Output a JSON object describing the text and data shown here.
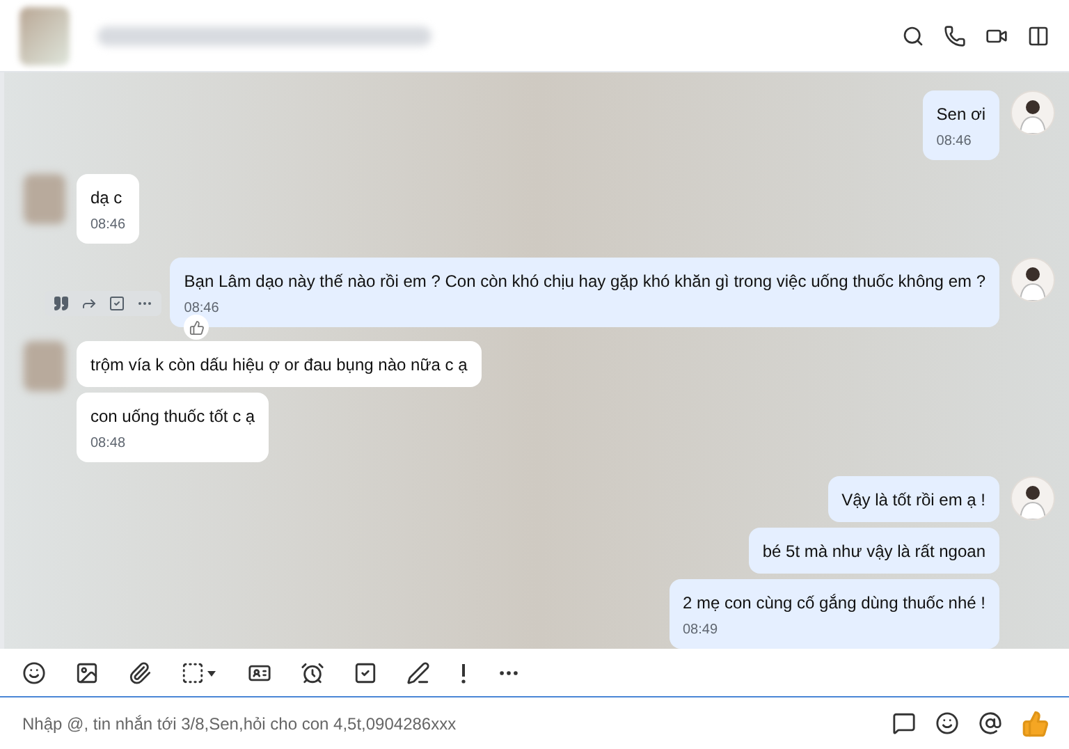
{
  "messages": [
    {
      "kind": "outgoing",
      "text": "Sen ơi",
      "time": "08:46",
      "avatar": true,
      "hovered": false
    },
    {
      "kind": "incoming",
      "text": "dạ c",
      "time": "08:46",
      "avatar": true,
      "hovered": false
    },
    {
      "kind": "outgoing",
      "text": "Bạn Lâm dạo này thế nào rồi em ? Con còn khó chịu hay gặp khó khăn gì trong việc uống thuốc không em ?",
      "time": "08:46",
      "avatar": true,
      "hovered": true
    },
    {
      "kind": "incoming",
      "text": "trộm vía k còn dấu hiệu ợ or đau bụng nào nữa c ạ",
      "avatar": true,
      "hovered": false
    },
    {
      "kind": "incoming",
      "text": "con uống thuốc tốt c ạ",
      "time": "08:48",
      "avatar": false,
      "hovered": false
    },
    {
      "kind": "outgoing",
      "text": "Vậy là tốt rồi em ạ !",
      "avatar": true,
      "hovered": false
    },
    {
      "kind": "outgoing",
      "text": "bé 5t mà như vậy là rất ngoan",
      "avatar": false,
      "hovered": false
    },
    {
      "kind": "outgoing",
      "text": "2 mẹ con cùng cố gắng dùng thuốc nhé !",
      "time": "08:49",
      "avatar": false,
      "hovered": false
    }
  ],
  "composer": {
    "placeholder": "Nhập @, tin nhắn tới 3/8,Sen,hỏi cho con 4,5t,0904286xxx"
  }
}
